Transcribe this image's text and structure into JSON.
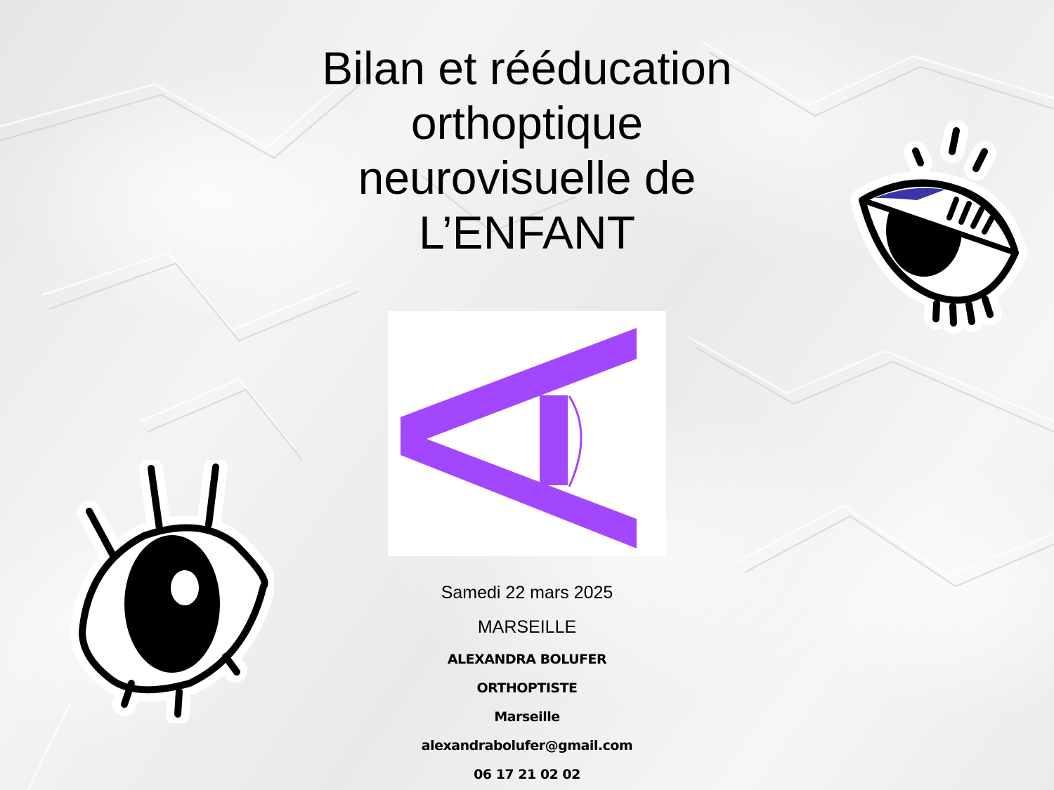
{
  "title": {
    "line1": "Bilan et rééducation",
    "line2": "orthoptique",
    "line3": "neurovisuelle de",
    "line4": "L’ENFANT"
  },
  "event": {
    "date": "Samedi 22 mars 2025",
    "city": "MARSEILLE"
  },
  "presenter": {
    "name": "ALEXANDRA BOLUFER",
    "profession": "ORTHOPTISTE",
    "location": "Marseille",
    "email": "alexandrabolufer@gmail.com",
    "phone": "06 17 21 02 02"
  },
  "logo": {
    "icon": "triangle-eye-logo",
    "color": "#a347ff"
  },
  "stickers": {
    "right_icon": "eye-sticker-icon",
    "left_icon": "eye-sticker-icon",
    "accent": "#3a35a8"
  }
}
